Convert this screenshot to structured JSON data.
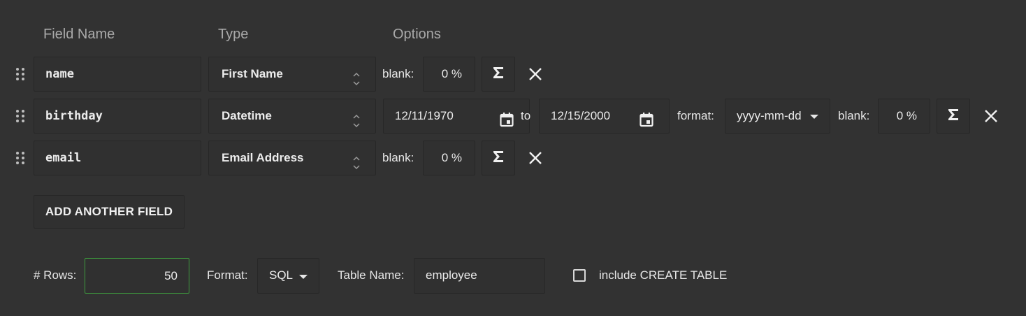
{
  "headers": {
    "field_name": "Field Name",
    "type": "Type",
    "options": "Options"
  },
  "fields": [
    {
      "name": "name",
      "type": "First Name",
      "blank_label": "blank:",
      "blank_value": "0 %"
    },
    {
      "name": "birthday",
      "type": "Datetime",
      "from_date": "12/11/1970",
      "to_label": "to",
      "to_date": "12/15/2000",
      "format_label": "format:",
      "format_value": "yyyy-mm-dd",
      "blank_label": "blank:",
      "blank_value": "0 %"
    },
    {
      "name": "email",
      "type": "Email Address",
      "blank_label": "blank:",
      "blank_value": "0 %"
    }
  ],
  "add_field_label": "ADD ANOTHER FIELD",
  "footer": {
    "rows_label": "# Rows:",
    "rows_value": "50",
    "format_label": "Format:",
    "format_value": "SQL",
    "table_name_label": "Table Name:",
    "table_name_value": "employee",
    "create_table_label": "include CREATE TABLE",
    "create_table_checked": false
  },
  "colors": {
    "background": "#323232",
    "input_border": "#272727",
    "focus_green": "#3e9a3e",
    "header_text": "#a9a9a9"
  },
  "icons": [
    "drag-handle-icon",
    "updown-arrows-icon",
    "sigma-icon",
    "close-icon",
    "calendar-icon",
    "caret-down-icon",
    "checkbox-icon"
  ]
}
